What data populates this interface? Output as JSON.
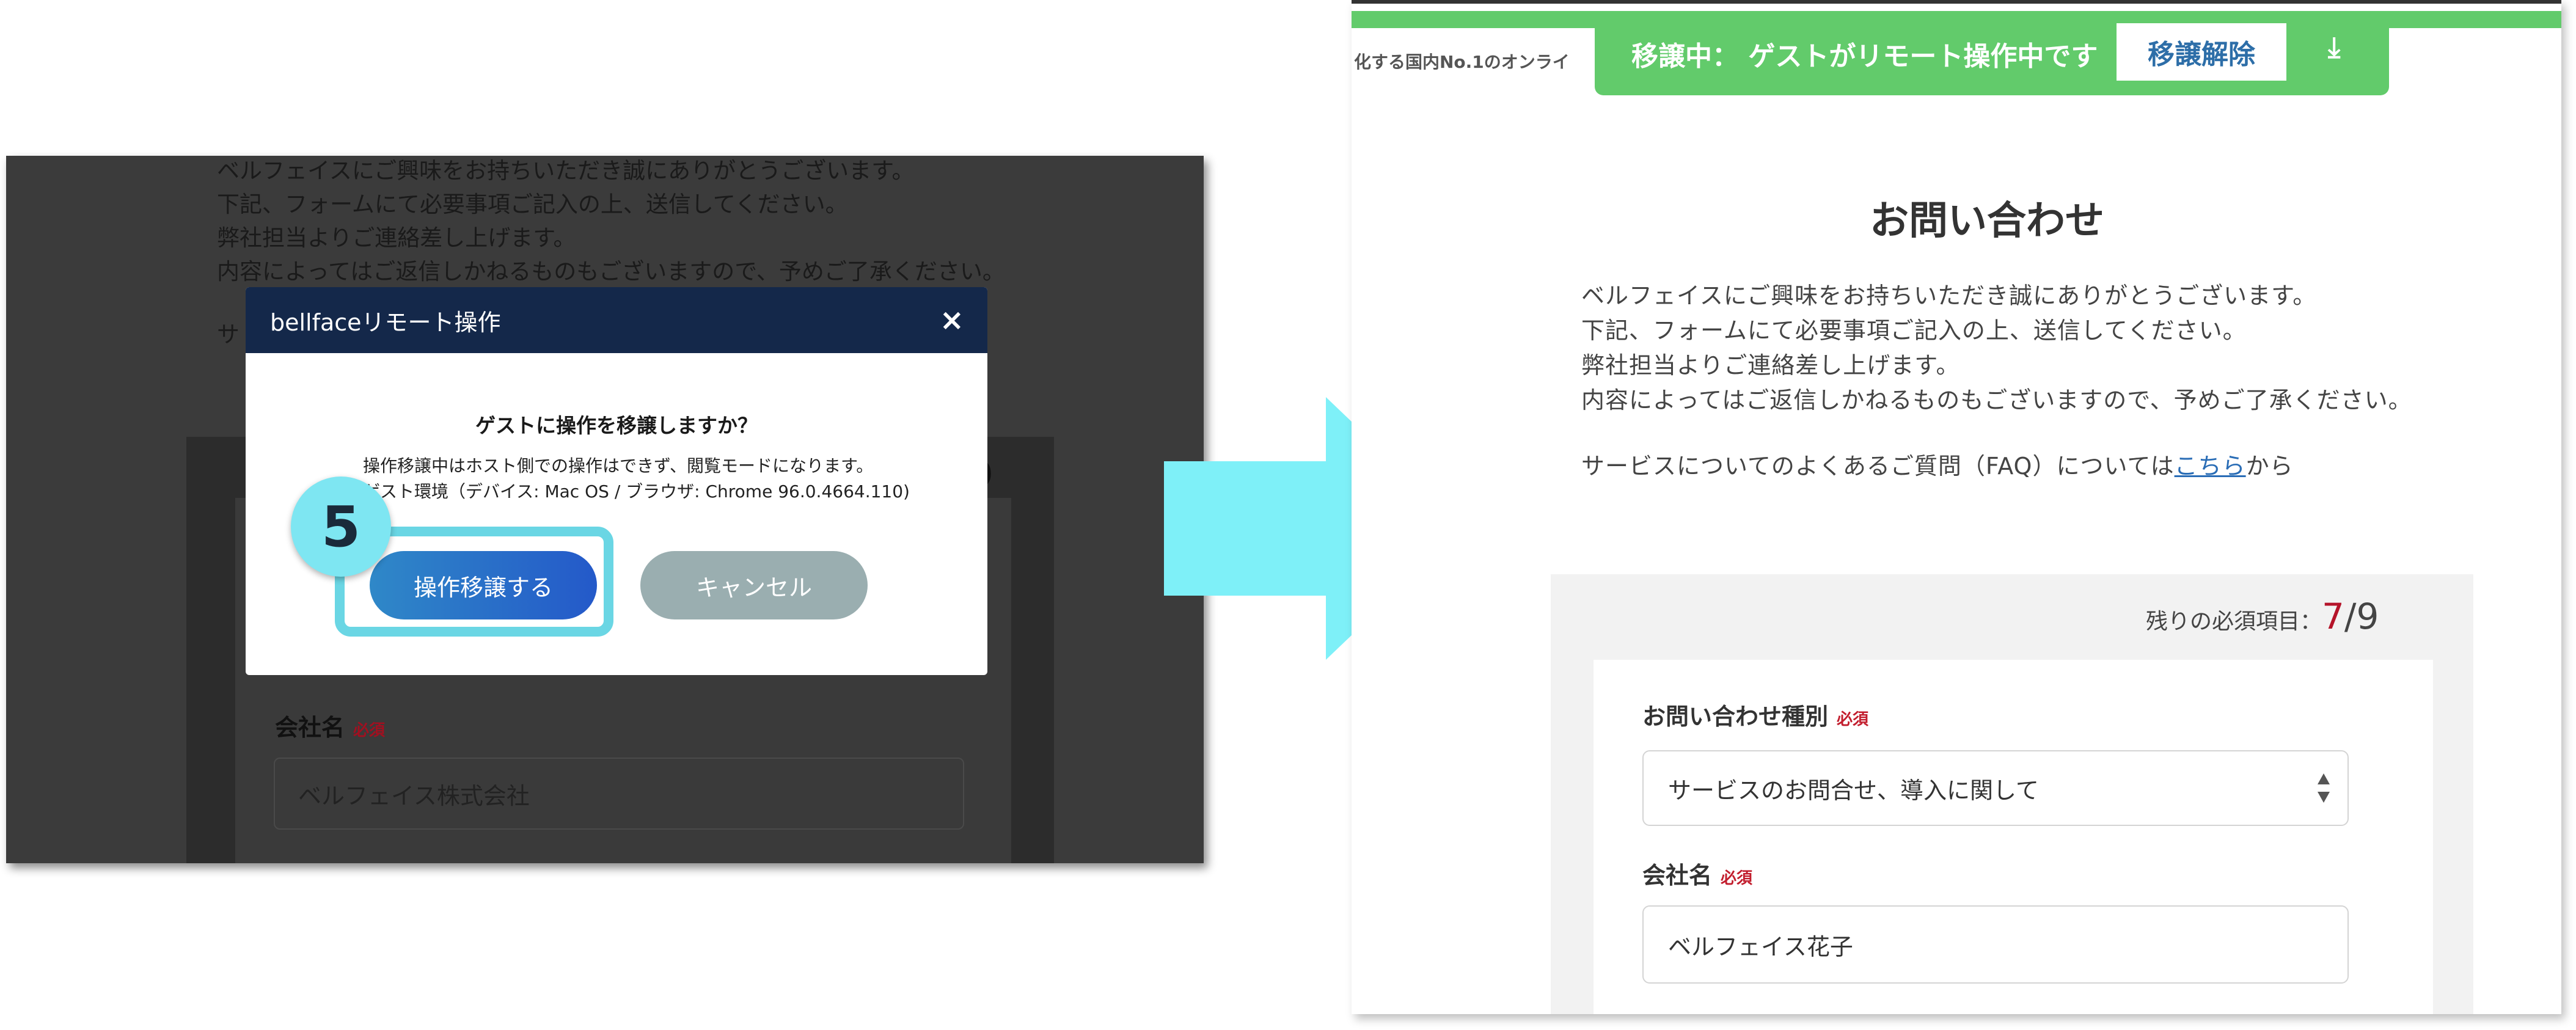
{
  "left": {
    "intro_lines": [
      "ベルフェイスにご興味をお持ちいただき誠にありがとうございます。",
      "下記、フォームにて必要事項ご記入の上、送信してください。",
      "弊社担当よりご連絡差し上げます。",
      "内容によってはご返信しかねるものもございますので、予めご了承ください。"
    ],
    "faq_fragment": "サ",
    "count_fragment": "9",
    "company_label": "会社名",
    "required_label": "必須",
    "company_placeholder": "ベルフェイス株式会社",
    "modal": {
      "title": "bellfaceリモート操作",
      "close": "×",
      "question": "ゲストに操作を移譲しますか？",
      "note_line1": "操作移譲中はホスト側での操作はできず、閲覧モードになります。",
      "note_line2": "ゲスト環境（デバイス: Mac OS / ブラウザ: Chrome 96.0.4664.110)",
      "confirm_button": "操作移譲する",
      "cancel_button": "キャンセル"
    },
    "step_number": "5"
  },
  "right": {
    "banner_text": "移譲中： ゲストがリモート操作中です",
    "banner_button": "移譲解除",
    "banner_download": "⤓",
    "cut_header": "化する国内No.1のオンライ",
    "title": "お問い合わせ",
    "intro_lines": [
      "ベルフェイスにご興味をお持ちいただき誠にありがとうございます。",
      "下記、フォームにて必要事項ご記入の上、送信してください。",
      "弊社担当よりご連絡差し上げます。",
      "内容によってはご返信しかねるものもございますので、予めご了承ください。"
    ],
    "faq_prefix": "サービスについてのよくあるご質問（FAQ）については",
    "faq_link": "こちら",
    "faq_suffix": "から",
    "remaining_label": "残りの必須項目：",
    "remaining_current": "7",
    "remaining_total": "9",
    "inquiry_type_label": "お問い合わせ種別",
    "required_label": "必須",
    "inquiry_type_value": "サービスのお問合せ、導入に関して",
    "company_label": "会社名",
    "company_value": "ベルフェイス花子"
  },
  "colors": {
    "banner_green": "#62cb6b",
    "arrow_cyan": "#7ef0f8",
    "modal_header": "#14284a",
    "highlight": "#6ad6e4"
  }
}
